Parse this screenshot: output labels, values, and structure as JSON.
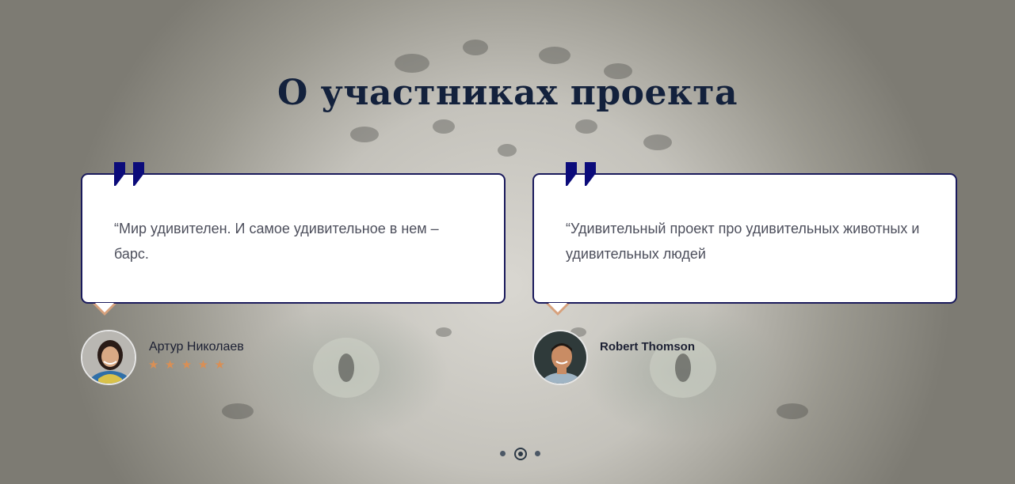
{
  "section": {
    "title": "О участниках проекта"
  },
  "testimonials": [
    {
      "quote": "“Мир удивителен. И самое удивительное в нем – барс.",
      "author": "Артур Николаев",
      "stars": [
        "★",
        "★",
        "★",
        "★",
        "★"
      ]
    },
    {
      "quote": "“Удивительный проект про удивительных животных и удивительных людей",
      "author": "Robert Thomson"
    }
  ],
  "carousel": {
    "pages": 3,
    "active": 2
  },
  "colors": {
    "accent": "#0b0b7a",
    "star": "#d98f55",
    "title": "#13213c",
    "border": "#1a1a5c"
  },
  "icons": {
    "quote": "quote-mark-icon",
    "star": "star-icon"
  }
}
